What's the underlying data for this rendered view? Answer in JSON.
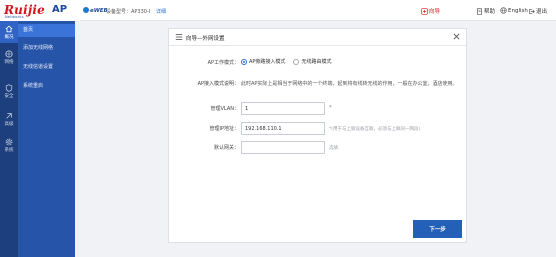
{
  "header": {
    "brand": "Ruijie",
    "brand_sub": "Networks",
    "product": "AP",
    "eweb": "eWEB",
    "device_model": "设备型号：AP330-I",
    "detail_link": "详细",
    "guide": "向导",
    "help": "帮助",
    "language": "English",
    "logout": "退出"
  },
  "rail": [
    {
      "label": "概况",
      "icon": "home-icon"
    },
    {
      "label": "网络",
      "icon": "network-icon"
    },
    {
      "label": "安全",
      "icon": "shield-icon"
    },
    {
      "label": "高级",
      "icon": "advanced-icon"
    },
    {
      "label": "系统",
      "icon": "gear-icon"
    }
  ],
  "submenu": [
    {
      "label": "首页"
    },
    {
      "label": "添加无线网络"
    },
    {
      "label": "无线信道设置"
    },
    {
      "label": "系统重启"
    }
  ],
  "panel": {
    "title": "向导—外网设置",
    "mode_label": "AP工作模式：",
    "mode_options": [
      "AP旁路接入模式",
      "无线路由模式"
    ],
    "mode_selected": "AP旁路接入模式",
    "desc_label": "AP接入模式说明：",
    "desc_text": "此时AP实际上是相当于网络中的一个终端，起到将有线转无线的作用，一般在办公室，酒店使用。",
    "vlan_label": "管理VLAN：",
    "vlan_value": "1",
    "vlan_required": "*",
    "ip_label": "管理IP地址：",
    "ip_value": "192.168.110.1",
    "ip_hint": "*(用于与上联设备互联，必须与上联同一网段)",
    "gateway_label": "默认网关：",
    "gateway_value": "",
    "gateway_hint": "选填",
    "next_label": "下一步"
  },
  "colors": {
    "brand_red": "#d0161b",
    "rail_bg": "#1d3f7d",
    "submenu_bg": "#2654a8",
    "active_blue": "#3a74d8",
    "button_blue": "#2460b8"
  }
}
